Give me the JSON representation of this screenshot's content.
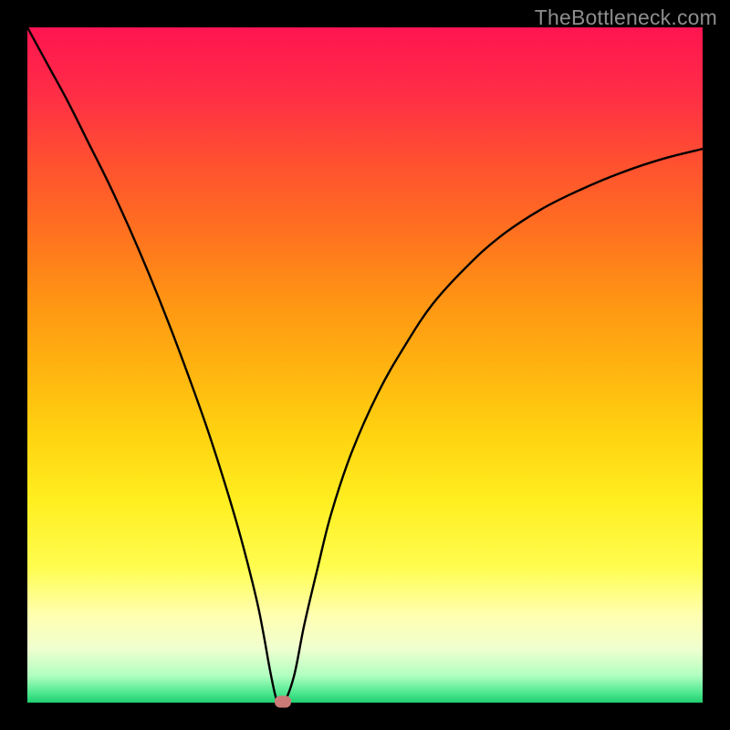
{
  "watermark": "TheBottleneck.com",
  "chart_data": {
    "type": "line",
    "title": "",
    "xlabel": "",
    "ylabel": "",
    "x_range": [
      0,
      1
    ],
    "y_range": [
      0,
      1
    ],
    "gradient_stops": [
      {
        "offset": 0.0,
        "color": "#ff1450"
      },
      {
        "offset": 0.1,
        "color": "#ff2e46"
      },
      {
        "offset": 0.2,
        "color": "#ff5030"
      },
      {
        "offset": 0.3,
        "color": "#ff7020"
      },
      {
        "offset": 0.4,
        "color": "#ff9314"
      },
      {
        "offset": 0.5,
        "color": "#ffb210"
      },
      {
        "offset": 0.6,
        "color": "#ffd210"
      },
      {
        "offset": 0.7,
        "color": "#ffee20"
      },
      {
        "offset": 0.8,
        "color": "#fffd50"
      },
      {
        "offset": 0.87,
        "color": "#ffffb0"
      },
      {
        "offset": 0.92,
        "color": "#f0ffd0"
      },
      {
        "offset": 0.96,
        "color": "#b0ffc0"
      },
      {
        "offset": 0.985,
        "color": "#50e890"
      },
      {
        "offset": 1.0,
        "color": "#1fcf6f"
      }
    ],
    "curve": {
      "minimum_x": 0.37,
      "left_branch": [
        {
          "x": 0.0,
          "y": 1.0
        },
        {
          "x": 0.03,
          "y": 0.945
        },
        {
          "x": 0.06,
          "y": 0.89
        },
        {
          "x": 0.09,
          "y": 0.83
        },
        {
          "x": 0.12,
          "y": 0.77
        },
        {
          "x": 0.15,
          "y": 0.705
        },
        {
          "x": 0.18,
          "y": 0.635
        },
        {
          "x": 0.21,
          "y": 0.56
        },
        {
          "x": 0.24,
          "y": 0.48
        },
        {
          "x": 0.27,
          "y": 0.395
        },
        {
          "x": 0.3,
          "y": 0.3
        },
        {
          "x": 0.32,
          "y": 0.23
        },
        {
          "x": 0.34,
          "y": 0.15
        },
        {
          "x": 0.35,
          "y": 0.1
        },
        {
          "x": 0.358,
          "y": 0.055
        },
        {
          "x": 0.365,
          "y": 0.02
        },
        {
          "x": 0.37,
          "y": 0.0
        }
      ],
      "right_branch": [
        {
          "x": 0.37,
          "y": 0.0
        },
        {
          "x": 0.38,
          "y": 0.0
        },
        {
          "x": 0.395,
          "y": 0.04
        },
        {
          "x": 0.41,
          "y": 0.115
        },
        {
          "x": 0.43,
          "y": 0.2
        },
        {
          "x": 0.45,
          "y": 0.28
        },
        {
          "x": 0.48,
          "y": 0.37
        },
        {
          "x": 0.52,
          "y": 0.46
        },
        {
          "x": 0.56,
          "y": 0.53
        },
        {
          "x": 0.6,
          "y": 0.59
        },
        {
          "x": 0.65,
          "y": 0.645
        },
        {
          "x": 0.7,
          "y": 0.69
        },
        {
          "x": 0.76,
          "y": 0.73
        },
        {
          "x": 0.82,
          "y": 0.76
        },
        {
          "x": 0.88,
          "y": 0.785
        },
        {
          "x": 0.94,
          "y": 0.805
        },
        {
          "x": 1.0,
          "y": 0.82
        }
      ]
    },
    "marker": {
      "x": 0.378,
      "y": 0.001,
      "color": "#cb7a77"
    }
  }
}
